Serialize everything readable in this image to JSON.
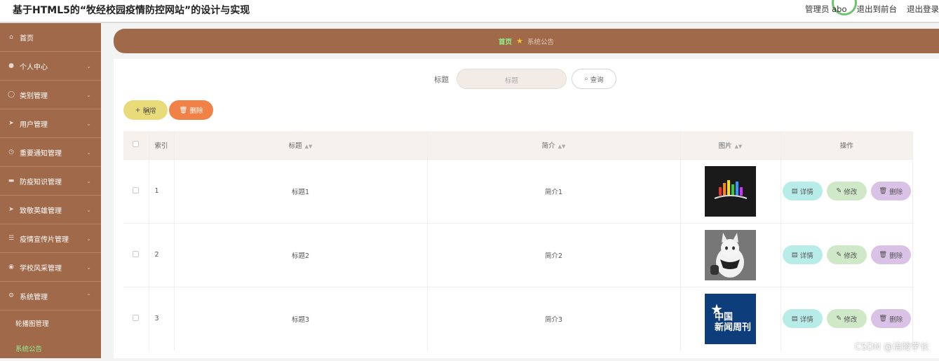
{
  "app": {
    "title": "基于HTML5的“牧经校园疫情防控网站”的设计与实现",
    "user_label": "管理员 abo",
    "front_link": "退出到前台",
    "logout_link": "退出登录"
  },
  "sidebar": {
    "items": [
      {
        "label": "首页",
        "icon": "home-icon"
      },
      {
        "label": "个人中心",
        "icon": "user-icon"
      },
      {
        "label": "类别管理",
        "icon": "info-icon"
      },
      {
        "label": "用户管理",
        "icon": "send-icon"
      },
      {
        "label": "重要通知管理",
        "icon": "clock-icon"
      },
      {
        "label": "防疫知识管理",
        "icon": "book-icon"
      },
      {
        "label": "致敬英雄管理",
        "icon": "send-icon"
      },
      {
        "label": "疫情宣传片管理",
        "icon": "list-icon"
      },
      {
        "label": "学校风采管理",
        "icon": "camera-icon"
      },
      {
        "label": "系统管理",
        "icon": "gear-icon"
      }
    ],
    "sub_items": [
      {
        "label": "轮播图管理"
      },
      {
        "label": "系统公告"
      }
    ]
  },
  "breadcrumb": {
    "home": "首页",
    "current": "系统公告"
  },
  "search": {
    "label": "标题",
    "placeholder": "标题",
    "button": "查询"
  },
  "toolbar": {
    "add": "新增",
    "delete": "删除"
  },
  "table": {
    "headers": {
      "index": "索引",
      "title": "标题",
      "intro": "简介",
      "image": "图片",
      "actions": "操作"
    },
    "rows": [
      {
        "index": "1",
        "title": "标题1",
        "intro": "简介1",
        "image": "music-equalizer-image"
      },
      {
        "index": "2",
        "title": "标题2",
        "intro": "简介2",
        "image": "cat-photo"
      },
      {
        "index": "3",
        "title": "标题3",
        "intro": "简介3",
        "image": "china-news-weekly-logo",
        "image_text": "中国\n新闻周刊"
      }
    ],
    "row_actions": {
      "detail": "详情",
      "edit": "修改",
      "remove": "删除"
    }
  },
  "watermark": "CSDN @涪陵学长",
  "colors": {
    "sidebar": "#a0694a",
    "accent_green": "#8ff08f",
    "add_button": "#eadb7a",
    "delete_button": "#f08248"
  }
}
